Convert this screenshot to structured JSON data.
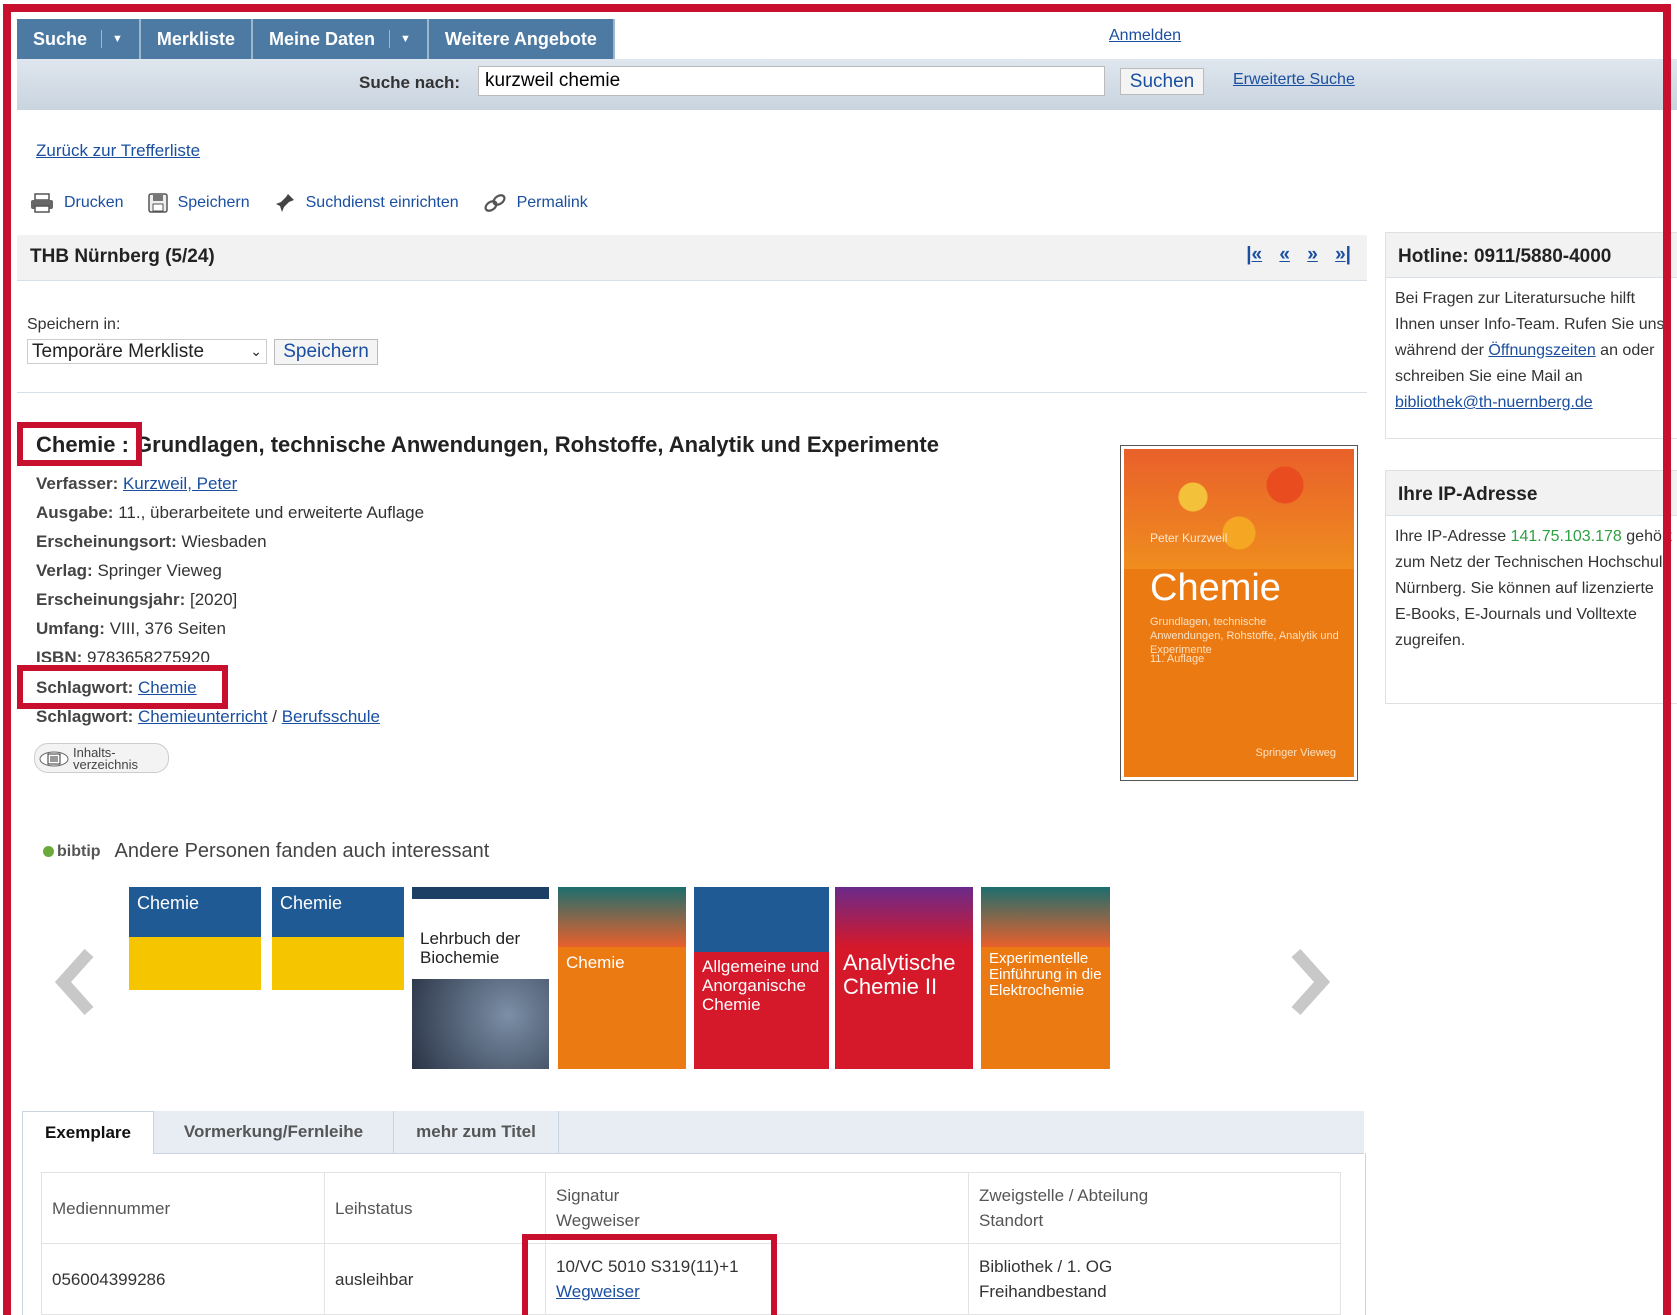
{
  "nav": {
    "tabs": [
      "Suche",
      "Merkliste",
      "Meine Daten",
      "Weitere Angebote"
    ],
    "login": "Anmelden"
  },
  "search": {
    "label": "Suche nach:",
    "value": "kurzweil chemie",
    "button": "Suchen",
    "advanced": "Erweiterte Suche"
  },
  "back_link": "Zurück zur Trefferliste",
  "tools": [
    "Drucken",
    "Speichern",
    "Suchdienst einrichten",
    "Permalink"
  ],
  "record": {
    "header": "THB Nürnberg (5/24)",
    "pager": [
      "«",
      "«",
      "»",
      "»"
    ]
  },
  "save": {
    "label": "Speichern in:",
    "selected": "Temporäre Merkliste",
    "button": "Speichern"
  },
  "book": {
    "title_main": "Chemie :",
    "title_rest": " Grundlagen, technische Anwendungen, Rohstoffe, Analytik und Experimente",
    "author_label": "Verfasser:",
    "author": "Kurzweil, Peter",
    "edition_label": "Ausgabe:",
    "edition": "11., überarbeitete und erweiterte Auflage",
    "place_label": "Erscheinungsort:",
    "place": "Wiesbaden",
    "publisher_label": "Verlag:",
    "publisher": "Springer Vieweg",
    "year_label": "Erscheinungsjahr:",
    "year": "[2020]",
    "extent_label": "Umfang:",
    "extent": "VIII, 376 Seiten",
    "isbn_label": "ISBN:",
    "isbn": "9783658275920",
    "subject_label": "Schlagwort:",
    "subject1": "Chemie",
    "subject2_label": "Schlagwort:",
    "subject2a": "Chemieunterricht",
    "subject2_sep": "/",
    "subject2b": "Berufsschule",
    "toc_line1": "Inhalts-",
    "toc_line2": "verzeichnis"
  },
  "cover": {
    "author": "Peter Kurzweil",
    "title": "Chemie",
    "subtitle": "Grundlagen, technische Anwendungen, Rohstoffe, Analytik und Experimente",
    "edition": "11. Auflage",
    "publisher": "Springer Vieweg"
  },
  "bibtip": {
    "logo": "bibtip",
    "text": "Andere Personen fanden auch interessant",
    "books": [
      {
        "title": "Chemie",
        "color": "#1f5a94"
      },
      {
        "title": "Chemie",
        "color": "#1f5a94"
      },
      {
        "title": "Lehrbuch der Biochemie",
        "color": "#ffffff"
      },
      {
        "title": "Chemie",
        "color": "#ec7a12"
      },
      {
        "title": "Allgemeine und Anorganische Chemie",
        "color": "#d5182a"
      },
      {
        "title": "Analytische Chemie II",
        "color": "#d5182a"
      },
      {
        "title": "Experimentelle Einführung in die Elektrochemie",
        "color": "#ec7a12"
      }
    ]
  },
  "sidebar": {
    "hotline_title": "Hotline: 0911/5880-4000",
    "hotline_text1": "Bei Fragen zur Literatursuche hilft Ihnen unser Info-Team. Rufen Sie uns während der ",
    "hotline_link": "Öffnungszeiten",
    "hotline_text2": " an oder schreiben Sie eine Mail an ",
    "hotline_mail": "bibliothek@th-nuernberg.de",
    "ip_title": "Ihre IP-Adresse",
    "ip_text1": "Ihre IP-Adresse ",
    "ip_value": "141.75.103.178",
    "ip_text2": " gehört zum Netz der Technischen Hochschule Nürnberg. Sie können auf lizenzierte E-Books, E-Journals und Volltexte zugreifen."
  },
  "holdings": {
    "tabs": [
      "Exemplare",
      "Vormerkung/Fernleihe",
      "mehr zum Titel"
    ],
    "headers": {
      "medium": "Mediennummer",
      "status": "Leihstatus",
      "signatur": "Signatur",
      "wegweiser": "Wegweiser",
      "branch": "Zweigstelle / Abteilung",
      "location": "Standort"
    },
    "row": {
      "medium": "056004399286",
      "status": "ausleihbar",
      "signatur": "10/VC 5010 S319(11)+1",
      "wegweiser": "Wegweiser",
      "branch": "Bibliothek / 1. OG",
      "location": "Freihandbestand"
    }
  }
}
